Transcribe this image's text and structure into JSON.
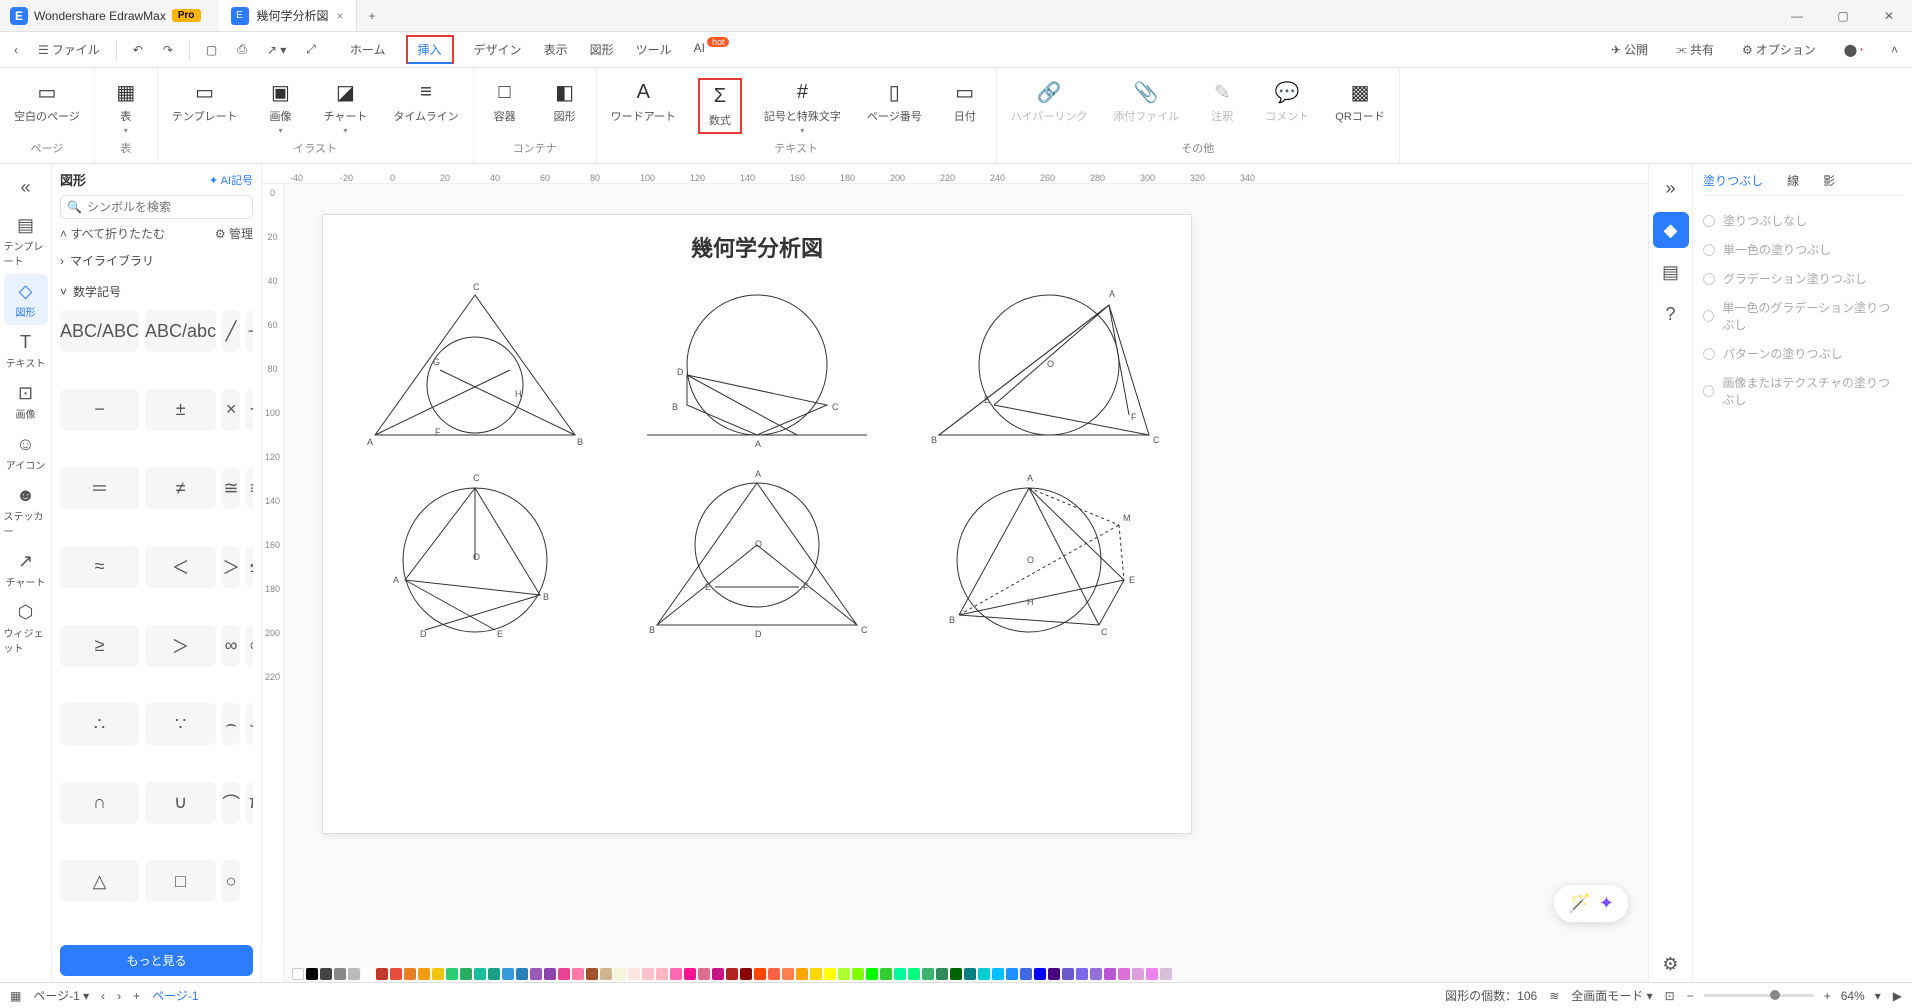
{
  "titlebar": {
    "app_name": "Wondershare EdrawMax",
    "pro": "Pro",
    "doc_title": "幾何学分析図",
    "close": "×",
    "new": "+"
  },
  "menubar": {
    "file": "ファイル",
    "tabs": [
      "ホーム",
      "挿入",
      "デザイン",
      "表示",
      "図形",
      "ツール",
      "AI"
    ],
    "active_tab_idx": 1,
    "hot": "hot",
    "right": {
      "publish": "公開",
      "share": "共有",
      "options": "オプション"
    }
  },
  "ribbon": {
    "groups": [
      {
        "label": "ページ",
        "items": [
          {
            "icon": "▭",
            "label": "空白のページ"
          }
        ]
      },
      {
        "label": "表",
        "items": [
          {
            "icon": "▦",
            "label": "表",
            "dd": true
          }
        ]
      },
      {
        "label": "イラスト",
        "items": [
          {
            "icon": "▭",
            "label": "テンプレート"
          },
          {
            "icon": "▣",
            "label": "画像",
            "dd": true
          },
          {
            "icon": "◪",
            "label": "チャート",
            "dd": true
          },
          {
            "icon": "≡",
            "label": "タイムライン"
          }
        ]
      },
      {
        "label": "コンテナ",
        "items": [
          {
            "icon": "□",
            "label": "容器"
          },
          {
            "icon": "◧",
            "label": "図形"
          }
        ]
      },
      {
        "label": "テキスト",
        "items": [
          {
            "icon": "A",
            "label": "ワードアート"
          },
          {
            "icon": "Σ",
            "label": "数式",
            "highlight": true
          },
          {
            "icon": "#",
            "label": "記号と特殊文字",
            "dd": true
          },
          {
            "icon": "▯",
            "label": "ページ番号"
          },
          {
            "icon": "▭",
            "label": "日付"
          }
        ]
      },
      {
        "label": "その他",
        "items": [
          {
            "icon": "🔗",
            "label": "ハイパーリンク",
            "disabled": true
          },
          {
            "icon": "📎",
            "label": "添付ファイル",
            "disabled": true
          },
          {
            "icon": "✎",
            "label": "注釈",
            "disabled": true
          },
          {
            "icon": "💬",
            "label": "コメント",
            "disabled": true
          },
          {
            "icon": "▩",
            "label": "QRコード"
          }
        ]
      }
    ]
  },
  "leftrail": [
    {
      "icon": "▤",
      "label": "テンプレート"
    },
    {
      "icon": "◇",
      "label": "図形",
      "active": true
    },
    {
      "icon": "T",
      "label": "テキスト"
    },
    {
      "icon": "⊡",
      "label": "画像"
    },
    {
      "icon": "☺",
      "label": "アイコン"
    },
    {
      "icon": "☻",
      "label": "ステッカー"
    },
    {
      "icon": "↗",
      "label": "チャート"
    },
    {
      "icon": "⬡",
      "label": "ウィジェット"
    }
  ],
  "leftpanel": {
    "title": "図形",
    "ai": "AI記号",
    "search_ph": "シンボルを検索",
    "collapse": "すべて折りたたむ",
    "manage": "管理",
    "lib": "マイライブラリ",
    "section": "数学記号",
    "symbols": [
      "ABC/ABC",
      "ABC/abc",
      "╱",
      "＋",
      "−",
      "±",
      "×",
      "÷",
      "＝",
      "≠",
      "≅",
      "≡",
      "≈",
      "＜",
      "＞",
      "≤",
      "≥",
      "＞",
      "∞",
      "∝",
      "∴",
      "∵",
      "⌢",
      "⌣",
      "∩",
      "∪",
      "⌒",
      "π",
      "△",
      "□",
      "○"
    ],
    "more": "もっと見る"
  },
  "canvas": {
    "title": "幾何学分析図",
    "ruler_h": [
      "-40",
      "-20",
      "0",
      "20",
      "40",
      "60",
      "80",
      "100",
      "120",
      "140",
      "160",
      "180",
      "200",
      "220",
      "240",
      "260",
      "280",
      "300",
      "320",
      "340"
    ],
    "ruler_v": [
      "0",
      "20",
      "40",
      "60",
      "80",
      "100",
      "120",
      "140",
      "160",
      "180",
      "200",
      "220"
    ]
  },
  "rightpanel": {
    "tabs": [
      "塗りつぶし",
      "線",
      "影"
    ],
    "active_tab": 0,
    "options": [
      "塗りつぶしなし",
      "単一色の塗りつぶし",
      "グラデーション塗りつぶし",
      "単一色のグラデーション塗りつぶし",
      "パターンの塗りつぶし",
      "画像またはテクスチャの塗りつぶし"
    ]
  },
  "statusbar": {
    "page_label": "ページ-1",
    "page_tab": "ページ-1",
    "count": "図形の個数：106",
    "mode": "全画面モード",
    "zoom": "64%"
  },
  "colors": [
    "#000",
    "#444",
    "#888",
    "#bbb",
    "#fff",
    "#c0392b",
    "#e74c3c",
    "#e67e22",
    "#f39c12",
    "#f1c40f",
    "#2ecc71",
    "#27ae60",
    "#1abc9c",
    "#16a085",
    "#3498db",
    "#2980b9",
    "#9b59b6",
    "#8e44ad",
    "#e84393",
    "#fd79a8",
    "#a0522d",
    "#d2b48c",
    "#f5f5dc",
    "#ffe4e1",
    "#ffc0cb",
    "#ffb6c1",
    "#ff69b4",
    "#ff1493",
    "#db7093",
    "#c71585",
    "#b22222",
    "#8b0000",
    "#ff4500",
    "#ff6347",
    "#ff7f50",
    "#ffa500",
    "#ffd700",
    "#ffff00",
    "#adff2f",
    "#7fff00",
    "#00ff00",
    "#32cd32",
    "#00fa9a",
    "#00ff7f",
    "#3cb371",
    "#2e8b57",
    "#006400",
    "#008080",
    "#00ced1",
    "#00bfff",
    "#1e90ff",
    "#4169e1",
    "#0000ff",
    "#4b0082",
    "#6a5acd",
    "#7b68ee",
    "#9370db",
    "#ba55d3",
    "#da70d6",
    "#dda0dd",
    "#ee82ee",
    "#d8bfd8"
  ]
}
